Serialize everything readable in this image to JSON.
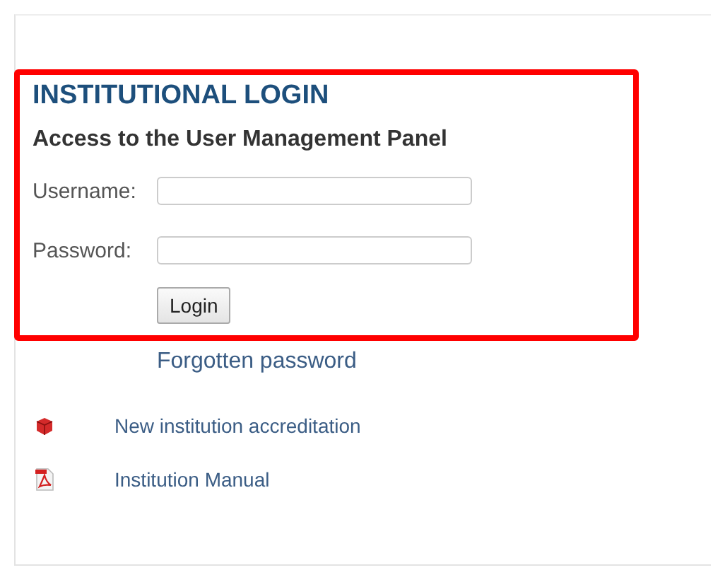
{
  "login": {
    "title": "INSTITUTIONAL LOGIN",
    "subtitle": "Access to the User Management Panel",
    "fields": [
      {
        "label": "Username:"
      },
      {
        "label": "Password:"
      }
    ],
    "button": "Login"
  },
  "forgotten_link": "Forgotten password",
  "links": [
    {
      "kind": "cube",
      "label": "New institution accreditation"
    },
    {
      "kind": "pdf",
      "label": "Institution Manual"
    }
  ]
}
